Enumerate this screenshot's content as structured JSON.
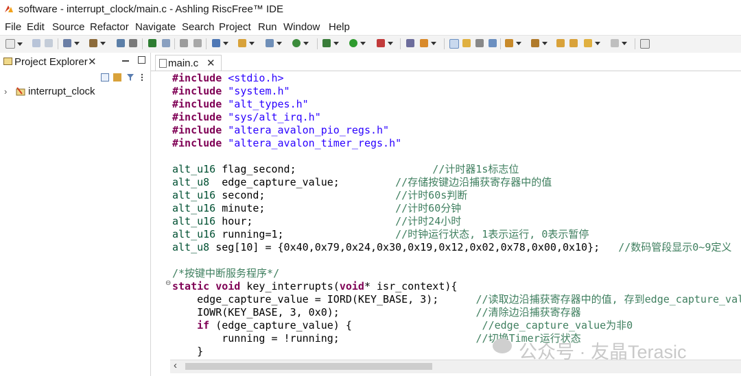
{
  "window": {
    "title": "software - interrupt_clock/main.c - Ashling RiscFree™ IDE"
  },
  "menubar": {
    "items": [
      "File",
      "Edit",
      "Source",
      "Refactor",
      "Navigate",
      "Search",
      "Project",
      "Run",
      "Window",
      "Help"
    ]
  },
  "left_panel": {
    "tab_label": "Project Explorer",
    "close_glyph": "✕",
    "tree": [
      {
        "chevron": "›",
        "label": "interrupt_clock"
      }
    ]
  },
  "editor": {
    "tab_label": "main.c",
    "close_glyph": "✕",
    "code_lines": [
      [
        {
          "t": "kw",
          "v": "#include "
        },
        {
          "t": "str",
          "v": "<stdio.h>"
        }
      ],
      [
        {
          "t": "kw",
          "v": "#include "
        },
        {
          "t": "str",
          "v": "\"system.h\""
        }
      ],
      [
        {
          "t": "kw",
          "v": "#include "
        },
        {
          "t": "str",
          "v": "\"alt_types.h\""
        }
      ],
      [
        {
          "t": "kw",
          "v": "#include "
        },
        {
          "t": "str",
          "v": "\"sys/alt_irq.h\""
        }
      ],
      [
        {
          "t": "kw",
          "v": "#include "
        },
        {
          "t": "str",
          "v": "\"altera_avalon_pio_regs.h\""
        }
      ],
      [
        {
          "t": "kw",
          "v": "#include "
        },
        {
          "t": "str",
          "v": "\"altera_avalon_timer_regs.h\""
        }
      ],
      [],
      [
        {
          "t": "type",
          "v": "alt_u16"
        },
        {
          "t": "txt",
          "v": " flag_second;                      "
        },
        {
          "t": "cmt",
          "v": "//计时器1s标志位"
        }
      ],
      [
        {
          "t": "type",
          "v": "alt_u8"
        },
        {
          "t": "txt",
          "v": "  edge_capture_value;         "
        },
        {
          "t": "cmt",
          "v": "//存储按键边沿捕获寄存器中的值"
        }
      ],
      [
        {
          "t": "type",
          "v": "alt_u16"
        },
        {
          "t": "txt",
          "v": " second;                     "
        },
        {
          "t": "cmt",
          "v": "//计时60s判断"
        }
      ],
      [
        {
          "t": "type",
          "v": "alt_u16"
        },
        {
          "t": "txt",
          "v": " minute;                     "
        },
        {
          "t": "cmt",
          "v": "//计时60分钟"
        }
      ],
      [
        {
          "t": "type",
          "v": "alt_u16"
        },
        {
          "t": "txt",
          "v": " hour;                       "
        },
        {
          "t": "cmt",
          "v": "//计时24小时"
        }
      ],
      [
        {
          "t": "type",
          "v": "alt_u16"
        },
        {
          "t": "txt",
          "v": " running=1;                  "
        },
        {
          "t": "cmt",
          "v": "//时钟运行状态, 1表示运行, 0表示暂停"
        }
      ],
      [
        {
          "t": "type",
          "v": "alt_u8"
        },
        {
          "t": "txt",
          "v": " seg[10] = {0x40,0x79,0x24,0x30,0x19,0x12,0x02,0x78,0x00,0x10};   "
        },
        {
          "t": "cmt",
          "v": "//数码管段显示0~9定义"
        }
      ],
      [],
      [
        {
          "t": "cmt",
          "v": "/*按键中断服务程序*/"
        }
      ],
      [
        {
          "t": "kw",
          "v": "static void"
        },
        {
          "t": "txt",
          "v": " "
        },
        {
          "t": "txt",
          "v": "key_interrupts("
        },
        {
          "t": "kw",
          "v": "void"
        },
        {
          "t": "txt",
          "v": "* isr_context){"
        }
      ],
      [
        {
          "t": "txt",
          "v": "    edge_capture_value = IORD(KEY_BASE, 3);      "
        },
        {
          "t": "cmt",
          "v": "//读取边沿捕获寄存器中的值, 存到edge_capture_value"
        }
      ],
      [
        {
          "t": "txt",
          "v": "    IOWR(KEY_BASE, 3, 0x0);                      "
        },
        {
          "t": "cmt",
          "v": "//清除边沿捕获寄存器"
        }
      ],
      [
        {
          "t": "kw",
          "v": "    if"
        },
        {
          "t": "txt",
          "v": " (edge_capture_value) {                     "
        },
        {
          "t": "cmt",
          "v": "//edge_capture_value为非0"
        }
      ],
      [
        {
          "t": "txt",
          "v": "        running = !running;                      "
        },
        {
          "t": "cmt",
          "v": "//切换Timer运行状态"
        }
      ],
      [
        {
          "t": "txt",
          "v": "    }"
        }
      ],
      [
        {
          "t": "txt",
          "v": "}"
        }
      ]
    ],
    "fold_marker": "⊖"
  },
  "watermark": {
    "text": "公众号 · 友晶Terasic"
  },
  "colors": {
    "keyword": "#7f0055",
    "string": "#2a00ff",
    "type": "#005032",
    "comment": "#3f7f5f"
  }
}
